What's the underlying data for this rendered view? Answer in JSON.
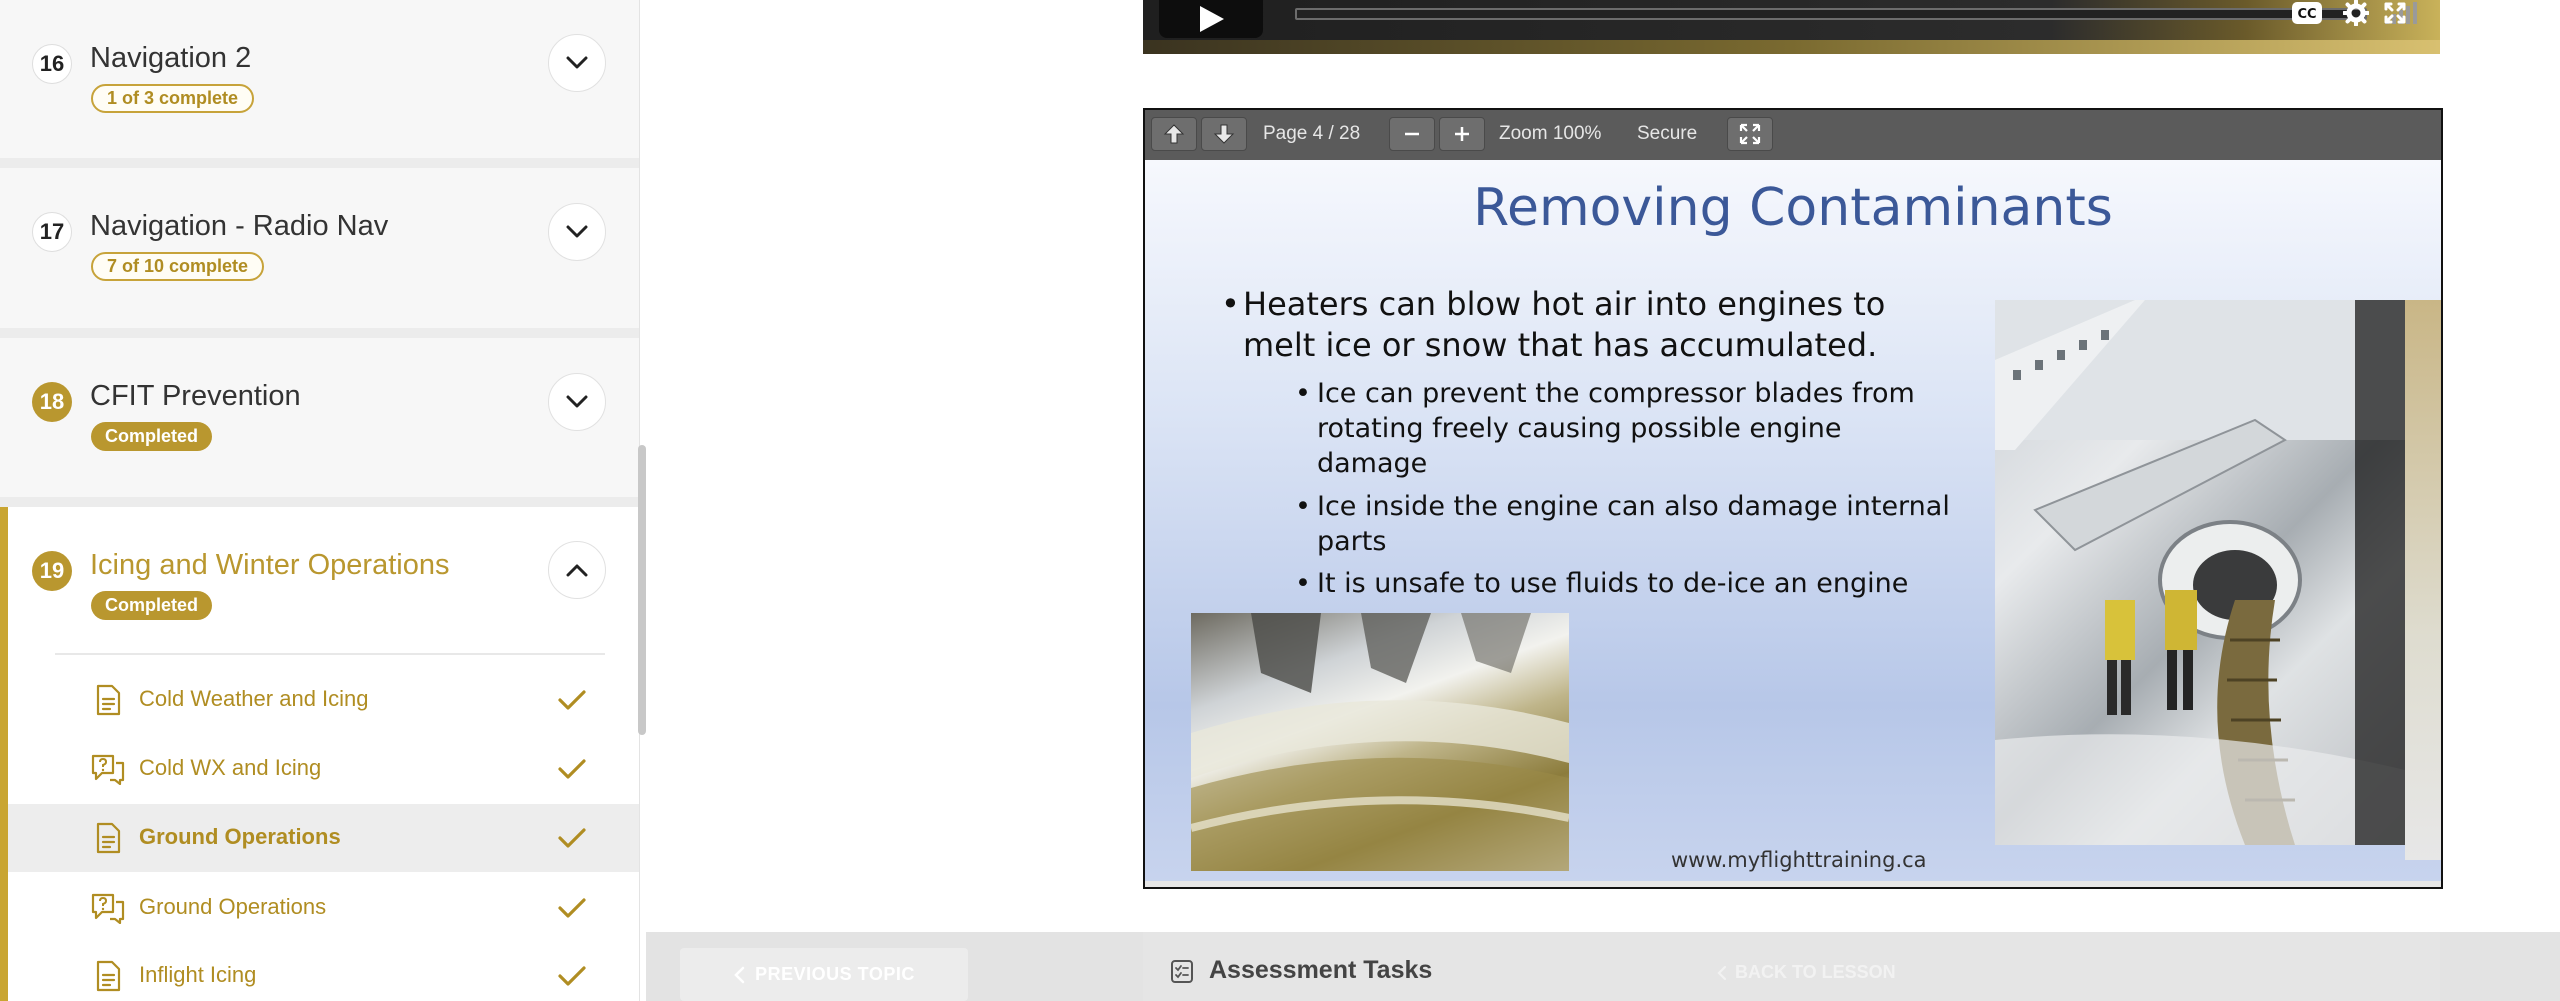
{
  "sidebar": {
    "topics": [
      {
        "number": "16",
        "title": "Navigation 2",
        "status": "1 of 3 complete"
      },
      {
        "number": "17",
        "title": "Navigation - Radio Nav",
        "status": "7 of 10 complete"
      },
      {
        "number": "18",
        "title": "CFIT Prevention",
        "status": "Completed"
      },
      {
        "number": "19",
        "title": "Icing and Winter Operations",
        "status": "Completed"
      }
    ],
    "lessons": [
      {
        "label": "Cold Weather and Icing",
        "icon": "document-icon"
      },
      {
        "label": "Cold WX and Icing",
        "icon": "quiz-icon"
      },
      {
        "label": "Ground Operations",
        "icon": "document-icon"
      },
      {
        "label": "Ground Operations",
        "icon": "quiz-icon"
      },
      {
        "label": "Inflight Icing",
        "icon": "document-icon"
      }
    ]
  },
  "viewer": {
    "page": "Page 4 / 28",
    "zoom": "Zoom 100%",
    "secure": "Secure"
  },
  "slide": {
    "title": "Removing Contaminants",
    "main_bullet": "Heaters can blow hot air into engines to melt ice or snow that has accumulated.",
    "sub_bullets": [
      "Ice can prevent the compressor blades from rotating freely causing possible engine damage",
      "Ice inside the engine can also damage internal parts",
      "It is unsafe to use fluids to de-ice an engine"
    ],
    "url": "www.myflighttraining.ca"
  },
  "footer": {
    "previous_topic": "PREVIOUS TOPIC",
    "assessment_tasks": "Assessment Tasks",
    "back_to_lesson": "BACK TO LESSON"
  },
  "colors": {
    "accent": "#b9972f",
    "slide_title": "#3b5898"
  }
}
